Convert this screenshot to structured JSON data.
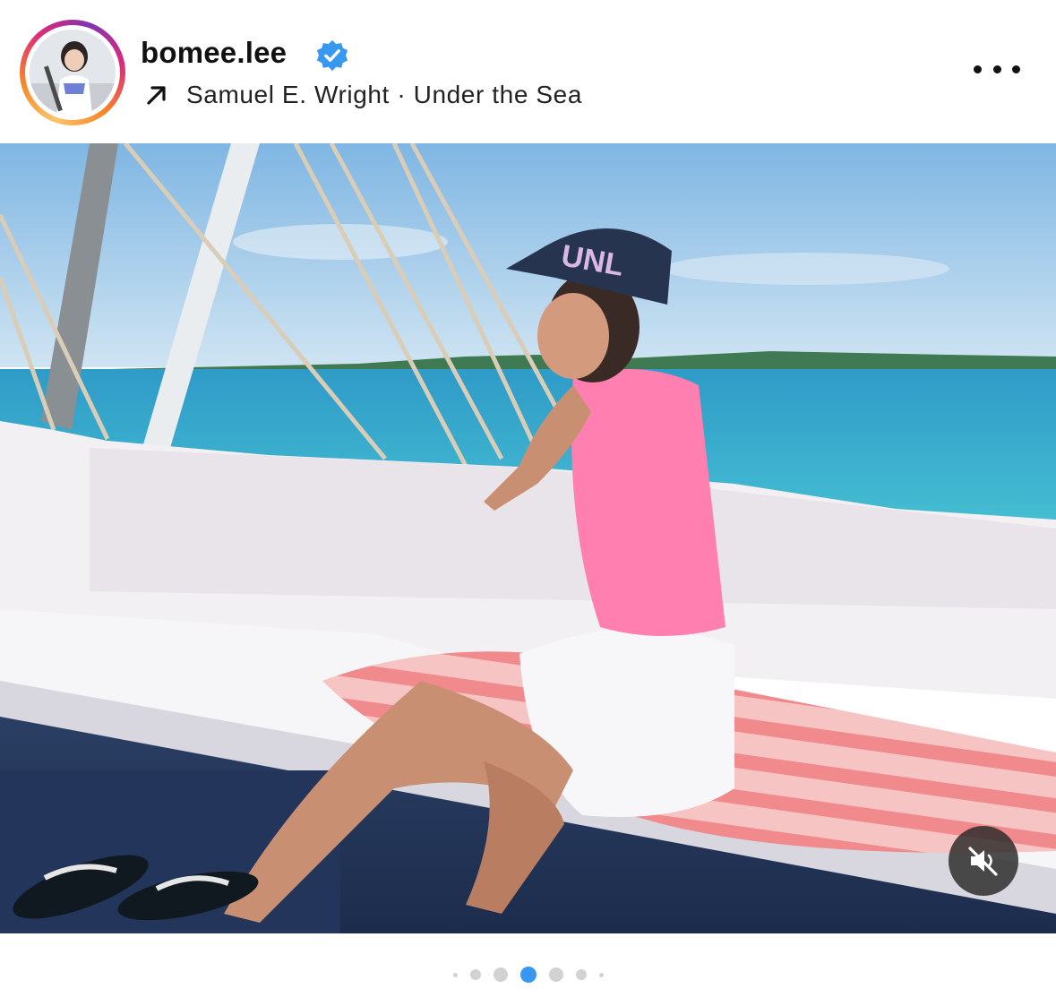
{
  "post_header": {
    "username": "bomee.lee",
    "verified": true,
    "music": "Samuel E. Wright · Under the Sea",
    "avatar_ring_colors": [
      "#fdc468",
      "#f58529",
      "#dd2a7b",
      "#8134af"
    ],
    "verified_color": "#3897f0"
  },
  "icons": {
    "verified": "verified-badge-icon",
    "music_arrow": "arrow-up-right-icon",
    "more": "more-options-icon",
    "mute": "speaker-muted-icon"
  },
  "media": {
    "current_slide": 4,
    "slide_count": 7,
    "muted": true,
    "active_dot_color": "#3897f0"
  }
}
